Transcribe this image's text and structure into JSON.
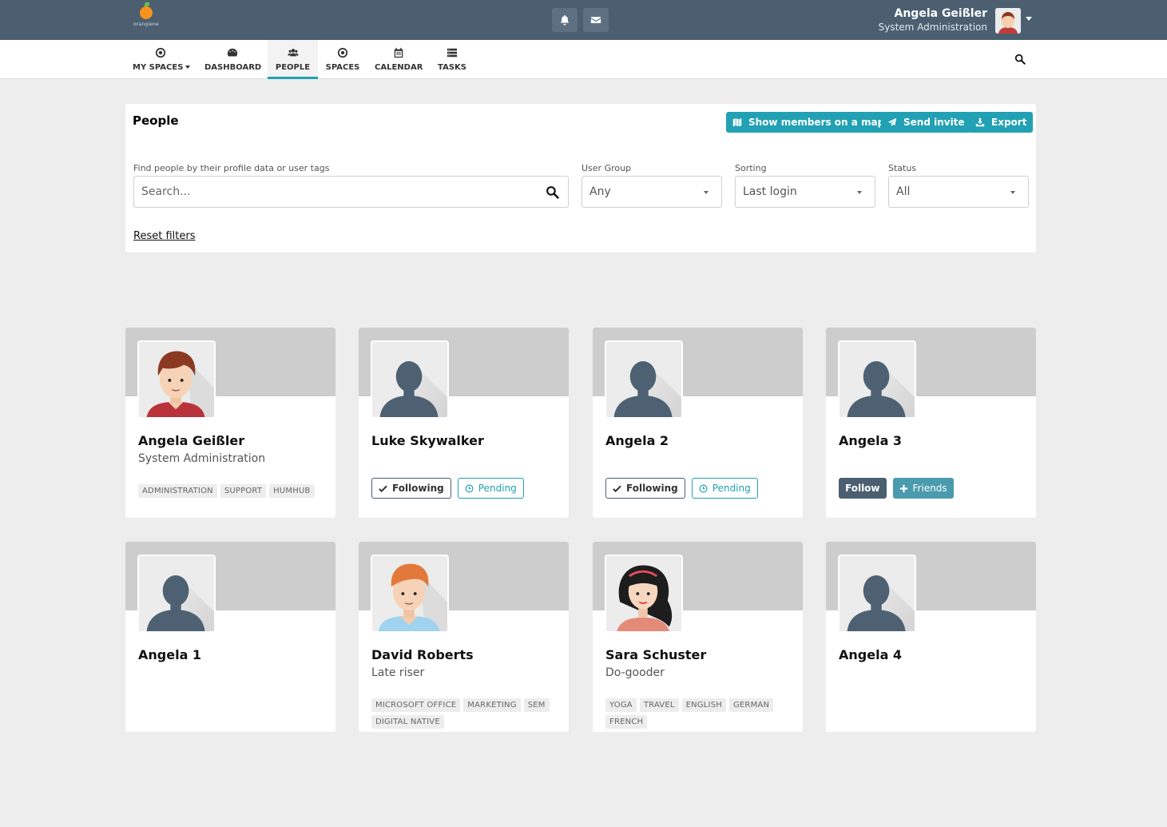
{
  "brand": {
    "logo_text": "orangiene"
  },
  "user": {
    "name": "Angela Geißler",
    "role": "System Administration"
  },
  "nav": [
    {
      "label": "MY SPACES",
      "icon": "dot-circle-icon"
    },
    {
      "label": "DASHBOARD",
      "icon": "dashboard-icon"
    },
    {
      "label": "PEOPLE",
      "icon": "users-icon"
    },
    {
      "label": "SPACES",
      "icon": "dot-circle-icon"
    },
    {
      "label": "CALENDAR",
      "icon": "calendar-icon"
    },
    {
      "label": "TASKS",
      "icon": "tasks-icon"
    }
  ],
  "directory": {
    "title": "People",
    "buttons": {
      "map": "Show members on a map",
      "invite": "Send invite",
      "export": "Export"
    },
    "filters": {
      "search_label": "Find people by their profile data or user tags",
      "search_placeholder": "Search...",
      "group_label": "User Group",
      "group_value": "Any",
      "sort_label": "Sorting",
      "sort_value": "Last login",
      "status_label": "Status",
      "status_value": "All"
    },
    "reset": "Reset filters"
  },
  "labels": {
    "following": "Following",
    "pending": "Pending",
    "follow": "Follow",
    "friends": "Friends"
  },
  "people": [
    {
      "name": "Angela Geißler",
      "title": "System Administration",
      "tags": [
        "ADMINISTRATION",
        "SUPPORT",
        "HUMHUB"
      ],
      "avatar": "man-brown",
      "status": "self"
    },
    {
      "name": "Luke Skywalker",
      "title": "",
      "tags": [],
      "avatar": "default",
      "status": "following"
    },
    {
      "name": "Angela 2",
      "title": "",
      "tags": [],
      "avatar": "default",
      "status": "following"
    },
    {
      "name": "Angela 3",
      "title": "",
      "tags": [],
      "avatar": "default",
      "status": "follow"
    },
    {
      "name": "Angela 1",
      "title": "",
      "tags": [],
      "avatar": "default",
      "status": "follow"
    },
    {
      "name": "David Roberts",
      "title": "Late riser",
      "tags": [
        "MICROSOFT OFFICE",
        "MARKETING",
        "SEM",
        "DIGITAL NATIVE"
      ],
      "avatar": "man-ginger",
      "status": "follow"
    },
    {
      "name": "Sara Schuster",
      "title": "Do-gooder",
      "tags": [
        "YOGA",
        "TRAVEL",
        "ENGLISH",
        "GERMAN",
        "FRENCH"
      ],
      "avatar": "woman",
      "status": "following"
    },
    {
      "name": "Angela 4",
      "title": "",
      "tags": [],
      "avatar": "default",
      "status": "follow"
    }
  ]
}
